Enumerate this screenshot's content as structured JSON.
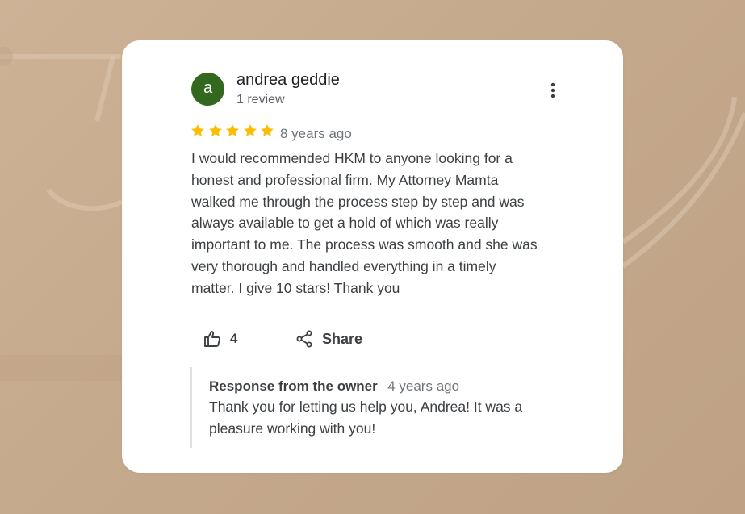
{
  "review": {
    "avatar_letter": "a",
    "author_name": "andrea geddie",
    "author_meta": "1 review",
    "rating": 5,
    "star_color": "#fbbc04",
    "date": "8 years ago",
    "text_lines": [
      "I would recommended HKM to anyone looking for a",
      "honest and professional firm.  My Attorney Mamta",
      "walked me through the process step by step and was",
      "always available to get a hold of which was really",
      "important to me. The process was smooth and she was",
      "very thorough and handled everything in a timely",
      "matter. I give 10 stars!  Thank you"
    ],
    "like_count": "4",
    "share_label": "Share",
    "more_icon": "more-vert-icon"
  },
  "response": {
    "title": "Response from the owner",
    "date": "4 years ago",
    "text_lines": [
      "Thank you for letting us help you, Andrea! It was a",
      "pleasure working with you!"
    ]
  },
  "colors": {
    "avatar_bg": "#33691e",
    "background": "#c5a98d",
    "card": "#ffffff"
  }
}
